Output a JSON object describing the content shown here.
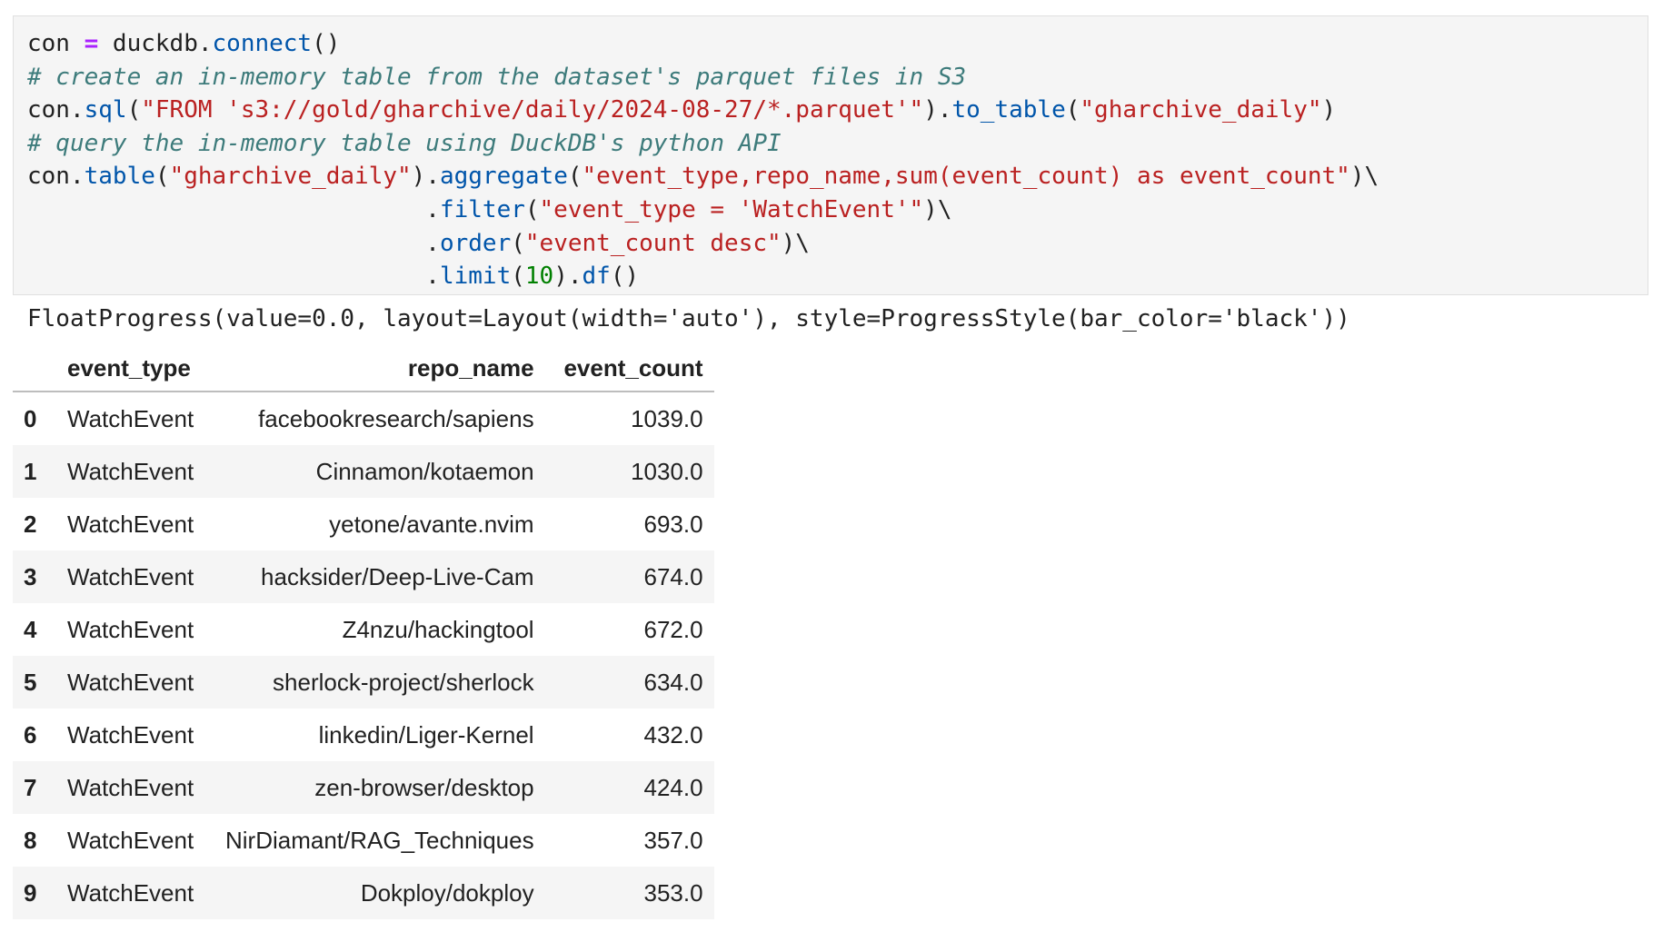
{
  "code_cell": {
    "lines": [
      [
        {
          "t": "con ",
          "c": "plain"
        },
        {
          "t": "=",
          "c": "op"
        },
        {
          "t": " duckdb.",
          "c": "plain"
        },
        {
          "t": "connect",
          "c": "fn"
        },
        {
          "t": "()",
          "c": "plain"
        }
      ],
      [
        {
          "t": "# create an in-memory table from the dataset's parquet files in S3",
          "c": "cm"
        }
      ],
      [
        {
          "t": "con.",
          "c": "plain"
        },
        {
          "t": "sql",
          "c": "fn"
        },
        {
          "t": "(",
          "c": "plain"
        },
        {
          "t": "\"FROM 's3://gold/gharchive/daily/2024-08-27/*.parquet'\"",
          "c": "str"
        },
        {
          "t": ").",
          "c": "plain"
        },
        {
          "t": "to_table",
          "c": "fn"
        },
        {
          "t": "(",
          "c": "plain"
        },
        {
          "t": "\"gharchive_daily\"",
          "c": "str"
        },
        {
          "t": ")",
          "c": "plain"
        }
      ],
      [
        {
          "t": "# query the in-memory table using DuckDB's python API",
          "c": "cm"
        }
      ],
      [
        {
          "t": "con.",
          "c": "plain"
        },
        {
          "t": "table",
          "c": "fn"
        },
        {
          "t": "(",
          "c": "plain"
        },
        {
          "t": "\"gharchive_daily\"",
          "c": "str"
        },
        {
          "t": ").",
          "c": "plain"
        },
        {
          "t": "aggregate",
          "c": "fn"
        },
        {
          "t": "(",
          "c": "plain"
        },
        {
          "t": "\"event_type,repo_name,sum(event_count) as event_count\"",
          "c": "str"
        },
        {
          "t": ")\\",
          "c": "plain"
        }
      ],
      [
        {
          "t": "                            .",
          "c": "plain"
        },
        {
          "t": "filter",
          "c": "fn"
        },
        {
          "t": "(",
          "c": "plain"
        },
        {
          "t": "\"event_type = 'WatchEvent'\"",
          "c": "str"
        },
        {
          "t": ")\\",
          "c": "plain"
        }
      ],
      [
        {
          "t": "                            .",
          "c": "plain"
        },
        {
          "t": "order",
          "c": "fn"
        },
        {
          "t": "(",
          "c": "plain"
        },
        {
          "t": "\"event_count desc\"",
          "c": "str"
        },
        {
          "t": ")\\",
          "c": "plain"
        }
      ],
      [
        {
          "t": "                            .",
          "c": "plain"
        },
        {
          "t": "limit",
          "c": "fn"
        },
        {
          "t": "(",
          "c": "plain"
        },
        {
          "t": "10",
          "c": "num"
        },
        {
          "t": ").",
          "c": "plain"
        },
        {
          "t": "df",
          "c": "fn"
        },
        {
          "t": "()",
          "c": "plain"
        }
      ]
    ]
  },
  "output": {
    "progress_text": "FloatProgress(value=0.0, layout=Layout(width='auto'), style=ProgressStyle(bar_color='black'))"
  },
  "table": {
    "columns": [
      "",
      "event_type",
      "repo_name",
      "event_count"
    ],
    "rows": [
      {
        "idx": "0",
        "event_type": "WatchEvent",
        "repo_name": "facebookresearch/sapiens",
        "event_count": "1039.0"
      },
      {
        "idx": "1",
        "event_type": "WatchEvent",
        "repo_name": "Cinnamon/kotaemon",
        "event_count": "1030.0"
      },
      {
        "idx": "2",
        "event_type": "WatchEvent",
        "repo_name": "yetone/avante.nvim",
        "event_count": "693.0"
      },
      {
        "idx": "3",
        "event_type": "WatchEvent",
        "repo_name": "hacksider/Deep-Live-Cam",
        "event_count": "674.0"
      },
      {
        "idx": "4",
        "event_type": "WatchEvent",
        "repo_name": "Z4nzu/hackingtool",
        "event_count": "672.0"
      },
      {
        "idx": "5",
        "event_type": "WatchEvent",
        "repo_name": "sherlock-project/sherlock",
        "event_count": "634.0"
      },
      {
        "idx": "6",
        "event_type": "WatchEvent",
        "repo_name": "linkedin/Liger-Kernel",
        "event_count": "432.0"
      },
      {
        "idx": "7",
        "event_type": "WatchEvent",
        "repo_name": "zen-browser/desktop",
        "event_count": "424.0"
      },
      {
        "idx": "8",
        "event_type": "WatchEvent",
        "repo_name": "NirDiamant/RAG_Techniques",
        "event_count": "357.0"
      },
      {
        "idx": "9",
        "event_type": "WatchEvent",
        "repo_name": "Dokploy/dokploy",
        "event_count": "353.0"
      }
    ]
  }
}
